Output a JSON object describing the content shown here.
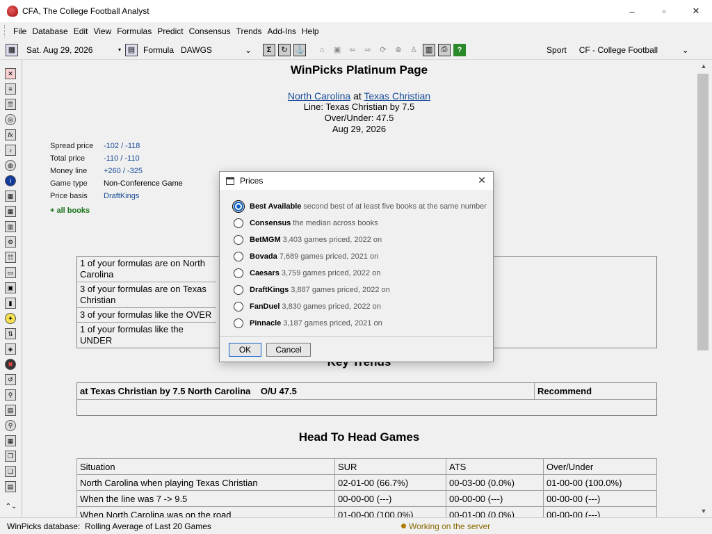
{
  "window": {
    "title": "CFA, The College Football Analyst",
    "minimize": "–",
    "restore": "▫",
    "close": "✕"
  },
  "menu": [
    "File",
    "Database",
    "Edit",
    "View",
    "Formulas",
    "Predict",
    "Consensus",
    "Trends",
    "Add-Ins",
    "Help"
  ],
  "toolbar": {
    "date": "Sat. Aug 29, 2026",
    "formula_label": "Formula",
    "formula_value": "DAWGS",
    "sport_label": "Sport",
    "sport_value": "CF - College Football"
  },
  "page": {
    "title": "WinPicks Platinum Page",
    "away_team": "North Carolina",
    "at": "at",
    "home_team": "Texas Christian",
    "line": "Line: Texas Christian by 7.5",
    "over_under": "Over/Under: 47.5",
    "date": "Aug 29, 2026",
    "prices": [
      {
        "key": "Spread price",
        "value": "-102 / -118"
      },
      {
        "key": "Total price",
        "value": "-110 / -110"
      },
      {
        "key": "Money line",
        "value": "+260 / -325"
      },
      {
        "key": "Game type",
        "value": "Non-Conference Game"
      },
      {
        "key": "Price basis",
        "value": "DraftKings"
      }
    ],
    "all_books": "+ all books",
    "formulas": [
      "1 of your formulas are on North Carolina",
      "3 of your formulas are on Texas Christian",
      "3 of your formulas like the OVER",
      "1 of your formulas like the UNDER"
    ],
    "key_trends_title": "Key Trends",
    "trend_header": "at Texas Christian by 7.5 North Carolina    O/U 47.5",
    "trend_recommend": "Recommend",
    "h2h_title": "Head To Head Games",
    "h2h_rows": [
      [
        "Situation",
        "SUR",
        "ATS",
        "Over/Under"
      ],
      [
        "North Carolina when playing Texas Christian",
        "02-01-00 (66.7%)",
        "00-03-00 (0.0%)",
        "01-00-00 (100.0%)"
      ],
      [
        "When the line was 7 -> 9.5",
        "00-00-00 (---)",
        "00-00-00 (---)",
        "00-00-00 (---)"
      ],
      [
        "When North Carolina was on the road",
        "01-00-00 (100.0%)",
        "00-01-00 (0.0%)",
        "00-00-00 (---)"
      ]
    ]
  },
  "status": {
    "left": "WinPicks database:  Rolling Average of Last 20 Games",
    "right": "Working on the server"
  },
  "dialog": {
    "title": "Prices",
    "close": "✕",
    "options": [
      {
        "name": "Best Available",
        "desc": "second best of at least five books at the same number",
        "checked": true
      },
      {
        "name": "Consensus",
        "desc": "the median across books",
        "checked": false
      },
      {
        "name": "BetMGM",
        "desc": "3,403 games priced, 2022 on",
        "checked": false
      },
      {
        "name": "Bovada",
        "desc": "7,689 games priced, 2021 on",
        "checked": false
      },
      {
        "name": "Caesars",
        "desc": "3,759 games priced, 2022 on",
        "checked": false
      },
      {
        "name": "DraftKings",
        "desc": "3,887 games priced, 2022 on",
        "checked": false
      },
      {
        "name": "FanDuel",
        "desc": "3,830 games priced, 2022 on",
        "checked": false
      },
      {
        "name": "Pinnacle",
        "desc": "3,187 games priced, 2021 on",
        "checked": false
      }
    ],
    "ok": "OK",
    "cancel": "Cancel"
  }
}
